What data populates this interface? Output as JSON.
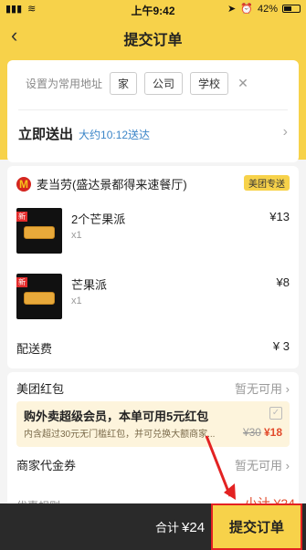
{
  "status": {
    "time": "上午9:42",
    "battery": "42%",
    "battery_level": 0.42
  },
  "nav": {
    "title": "提交订单",
    "back_icon": "chevron-left-icon"
  },
  "address": {
    "label": "设置为常用地址",
    "tags": [
      "家",
      "公司",
      "学校"
    ]
  },
  "delivery": {
    "title": "立即送出",
    "eta": "大约10:12送达"
  },
  "shop": {
    "name": "麦当劳(盛达景都得来速餐厅)",
    "badge": "美团专送"
  },
  "items": [
    {
      "name": "2个芒果派",
      "qty": "x1",
      "price": "¥13",
      "tag": "新"
    },
    {
      "name": "芒果派",
      "qty": "x1",
      "price": "¥8",
      "tag": "新"
    }
  ],
  "fee": {
    "label": "配送费",
    "value": "¥ 3"
  },
  "promo": {
    "redpacket_label": "美团红包",
    "redpacket_status": "暂无可用",
    "member_title": "购外卖超级会员，本单可用5元红包",
    "member_desc": "内含超过30元无门槛红包，并可兑换大额商家...",
    "member_old_price": "¥30",
    "member_new_price": "¥18",
    "coupon_label": "商家代金券",
    "coupon_status": "暂无可用",
    "rule_label": "优惠规则"
  },
  "footer": {
    "total_label": "合计",
    "total_value": "¥24",
    "subtotal": "小计 ¥24",
    "submit_label": "提交订单"
  },
  "colors": {
    "brand_yellow": "#f7d24a",
    "price_red": "#e24a2b",
    "link_blue": "#3c86c8",
    "annotation_red": "#e32222"
  }
}
